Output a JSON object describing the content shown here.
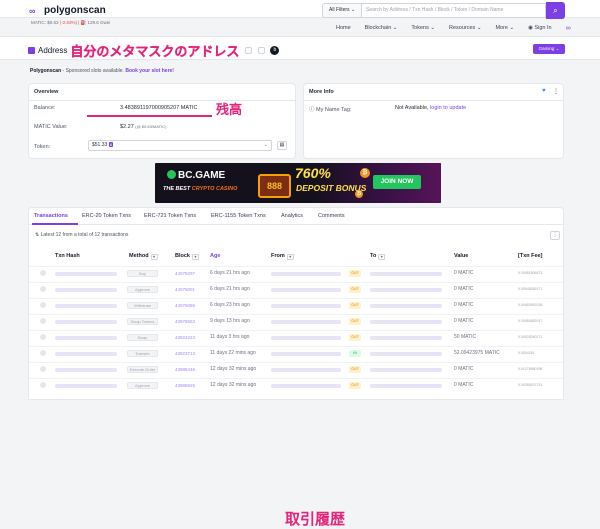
{
  "topbar": {
    "logo": "polygonscan",
    "matic_label": "MATIC:",
    "matic_price": "$0.63",
    "matic_change": "(-2.63%)",
    "gas": "129.6 Gwei",
    "filters_label": "All Filters",
    "search_placeholder": "Search by Address / Txn Hash / Block / Token / Domain Name"
  },
  "nav": {
    "home": "Home",
    "blockchain": "Blockchain",
    "tokens": "Tokens",
    "resources": "Resources",
    "more": "More",
    "sign_in": "Sign In"
  },
  "header": {
    "address_label": "Address",
    "annotation": "自分のメタマスクのアドレス",
    "badge": "b",
    "gaming_label": "Gaming"
  },
  "sponsor": {
    "brand": "Polygonscan",
    "text": "- Sponsored slots available.",
    "link": "Book your slot here!"
  },
  "overview": {
    "title": "Overview",
    "balance_label": "Balance:",
    "balance_value": "3.483891197000905207 MATIC",
    "balance_annotation": "残高",
    "matic_value_label": "MATIC Value:",
    "matic_value": "$2.27",
    "matic_value_rate": "(@ $0.63/MATIC)",
    "token_label": "Token:",
    "token_value": "$51.33",
    "token_count": "8"
  },
  "moreinfo": {
    "title": "More Info",
    "name_tag_label": "My Name Tag:",
    "name_tag_value": "Not Available,",
    "name_tag_link": "login to update"
  },
  "banner": {
    "brand": "BC.GAME",
    "tagline_1": "THE BEST",
    "tagline_2": "CRYPTO CASINO",
    "slot": "888",
    "percent": "760%",
    "deposit": "DEPOSIT BONUS",
    "join": "JOIN NOW",
    "coin": "₿"
  },
  "tabs": [
    "Transactions",
    "ERC-20 Token Txns",
    "ERC-721 Token Txns",
    "ERC-1155 Token Txns",
    "Analytics",
    "Comments"
  ],
  "transactions": {
    "summary": "Latest 12 from a total of 12 transactions",
    "annotation": "取引履歴",
    "columns": {
      "hash": "Txn Hash",
      "method": "Method",
      "block": "Block",
      "age": "Age",
      "from": "From",
      "to": "To",
      "value": "Value",
      "fee": "[Txn Fee]"
    },
    "rows": [
      {
        "method": "Buy",
        "block": "44078297",
        "age": "6 days 21 hrs ago",
        "dir": "OUT",
        "value": "0 MATIC",
        "fee": "0.00981806873"
      },
      {
        "method": "Approve",
        "block": "44075001",
        "age": "6 days 21 hrs ago",
        "dir": "OUT",
        "value": "0 MATIC",
        "fee": "0.00548382471"
      },
      {
        "method": "Withdraw",
        "block": "44076086",
        "age": "6 days 23 hrs ago",
        "dir": "OUT",
        "value": "0 MATIC",
        "fee": "0.00683952018"
      },
      {
        "method": "Swap Tokens",
        "block": "43978553",
        "age": "9 days 13 hrs ago",
        "dir": "OUT",
        "value": "0 MATIC",
        "fee": "0.00984582017"
      },
      {
        "method": "Swap",
        "block": "43924223",
        "age": "11 days 3 hrs ago",
        "dir": "OUT",
        "value": "50 MATIC",
        "fee": "0.00528340271"
      },
      {
        "method": "Transfer",
        "block": "43923713",
        "age": "11 days 22 mins ago",
        "dir": "IN",
        "value": "52.09423975 MATIC",
        "fee": "0.0004241"
      },
      {
        "method": "Execute Order",
        "block": "43888446",
        "age": "12 days 32 mins ago",
        "dir": "OUT",
        "value": "0 MATIC",
        "fee": "0.01276580198"
      },
      {
        "method": "Approve",
        "block": "43888825",
        "age": "12 days 32 mins ago",
        "dir": "OUT",
        "value": "0 MATIC",
        "fee": "0.00358207231"
      }
    ]
  }
}
